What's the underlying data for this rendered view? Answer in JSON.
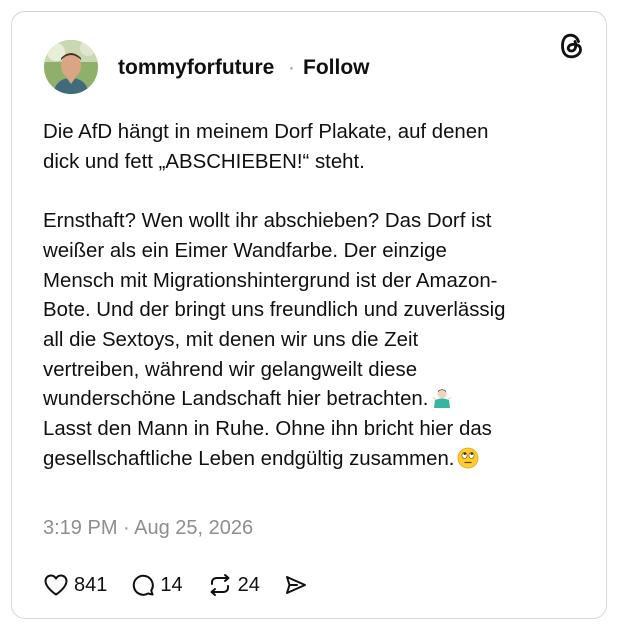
{
  "post": {
    "username": "tommyforfuture",
    "separator": "·",
    "follow_label": "Follow",
    "paragraph1": "Die AfD hängt in meinem Dorf Plakate, auf denen\ndick und fett „ABSCHIEBEN!“ steht.",
    "paragraph2": "Ernsthaft? Wen wollt ihr abschieben? Das Dorf ist\nweißer als ein Eimer Wandfarbe. Der einzige\nMensch mit Migrationshintergrund ist der Amazon-\nBote. Und der bringt uns freundlich und zuverlässig\nall die Sextoys, mit denen wir uns die Zeit\nvertreiben, während wir gelangweilt diese\nwunderschöne Landschaft hier betrachten.",
    "paragraph2_emoji": "man-shrugging-emoji",
    "paragraph2_tail": "Lasst den Mann in Ruhe. Ohne ihn bricht hier das\ngesellschaftliche Leben endgültig zusammen.",
    "tail_emoji": "face-with-rolling-eyes-emoji",
    "timestamp": "3:19 PM · Aug 25, 2026"
  },
  "actions": {
    "likes": "841",
    "replies": "14",
    "reposts": "24",
    "like_icon": "heart-icon",
    "reply_icon": "comment-bubble-icon",
    "repost_icon": "repost-arrows-icon",
    "share_icon": "send-icon"
  },
  "brand": {
    "logo": "threads-logo-icon"
  }
}
